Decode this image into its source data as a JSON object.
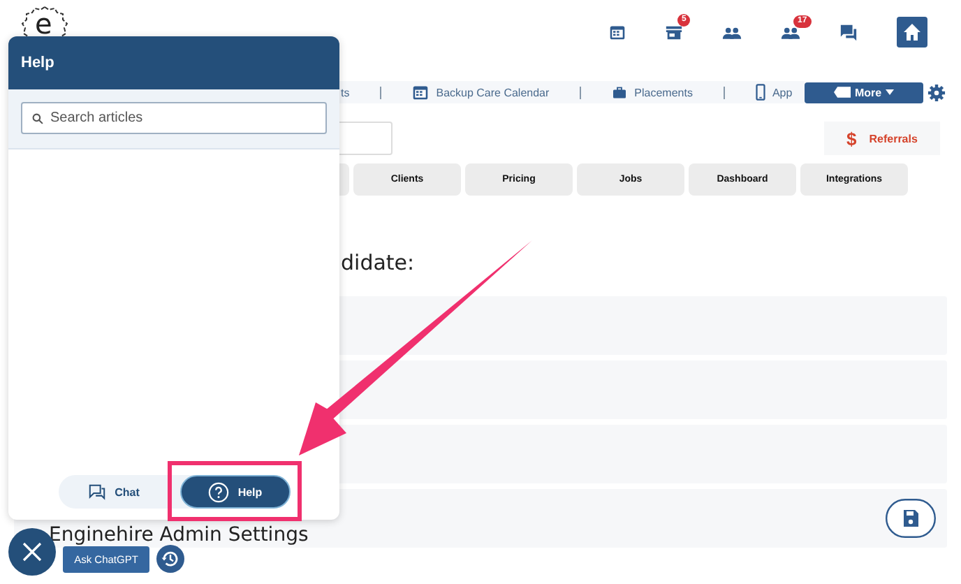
{
  "logo": {
    "letter": "e"
  },
  "top_icons": [
    {
      "kind": "calendar"
    },
    {
      "kind": "store",
      "badge": "5"
    },
    {
      "kind": "people"
    },
    {
      "kind": "people",
      "badge": "17"
    },
    {
      "kind": "chat"
    },
    {
      "kind": "home"
    }
  ],
  "nav": {
    "items": [
      {
        "kind": "plain",
        "label": "ts"
      },
      {
        "kind": "calendar",
        "label": "Backup Care Calendar"
      },
      {
        "kind": "briefcase",
        "label": "Placements"
      },
      {
        "kind": "phone",
        "label": "App"
      }
    ],
    "more_button": "More"
  },
  "referrals": {
    "symbol": "$",
    "label": "Referrals"
  },
  "tabs": [
    {
      "label": "Clients"
    },
    {
      "label": "Pricing"
    },
    {
      "label": "Jobs"
    },
    {
      "label": "Dashboard"
    },
    {
      "label": "Integrations"
    }
  ],
  "heading": "didate:",
  "settings_title": "Enginehire Admin Settings",
  "help_panel": {
    "title": "Help",
    "search": {
      "placeholder": "Search articles"
    },
    "tabs": [
      {
        "kind": "chat",
        "label": "Chat",
        "selected": false
      },
      {
        "kind": "help",
        "label": "Help",
        "selected": true
      }
    ]
  },
  "launcher": {
    "ask_button": "Ask ChatGPT"
  }
}
